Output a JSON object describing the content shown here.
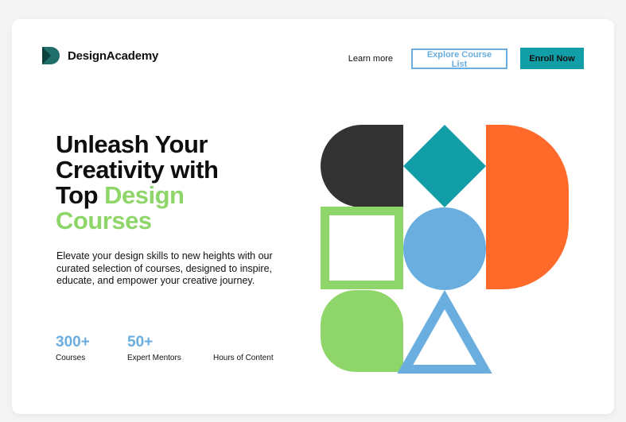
{
  "brand": {
    "name": "DesignAcademy",
    "logo_icon": "design-academy-logo-icon",
    "logo_color": "#1f6e6a"
  },
  "nav": {
    "learn_more": "Learn more",
    "explore": "Explore Course List",
    "enroll": "Enroll Now"
  },
  "hero": {
    "title_line1": "Unleash Your",
    "title_line2": "Creativity with",
    "title_line3_plain": "Top ",
    "title_line3_accent": "Design",
    "title_line4_accent": "Courses",
    "description": "Elevate your design skills to new heights with our curated selection of courses, designed to inspire, educate, and empower your creative journey."
  },
  "stats": [
    {
      "value": "300+",
      "label": "Courses"
    },
    {
      "value": "50+",
      "label": "Expert Mentors"
    },
    {
      "value": "",
      "label": "Hours of Content"
    }
  ],
  "colors": {
    "accent_green": "#8ed66a",
    "accent_blue": "#6aaee0",
    "teal": "#129ea6",
    "orange": "#ff6a2b",
    "dark": "#333333"
  },
  "illustration": {
    "shapes": [
      "dark-rounded-block-shape",
      "teal-diamond-shape",
      "orange-d-shape",
      "green-square-outline-shape",
      "blue-circle-shape",
      "green-leaf-shape",
      "blue-triangle-outline-shape"
    ]
  }
}
